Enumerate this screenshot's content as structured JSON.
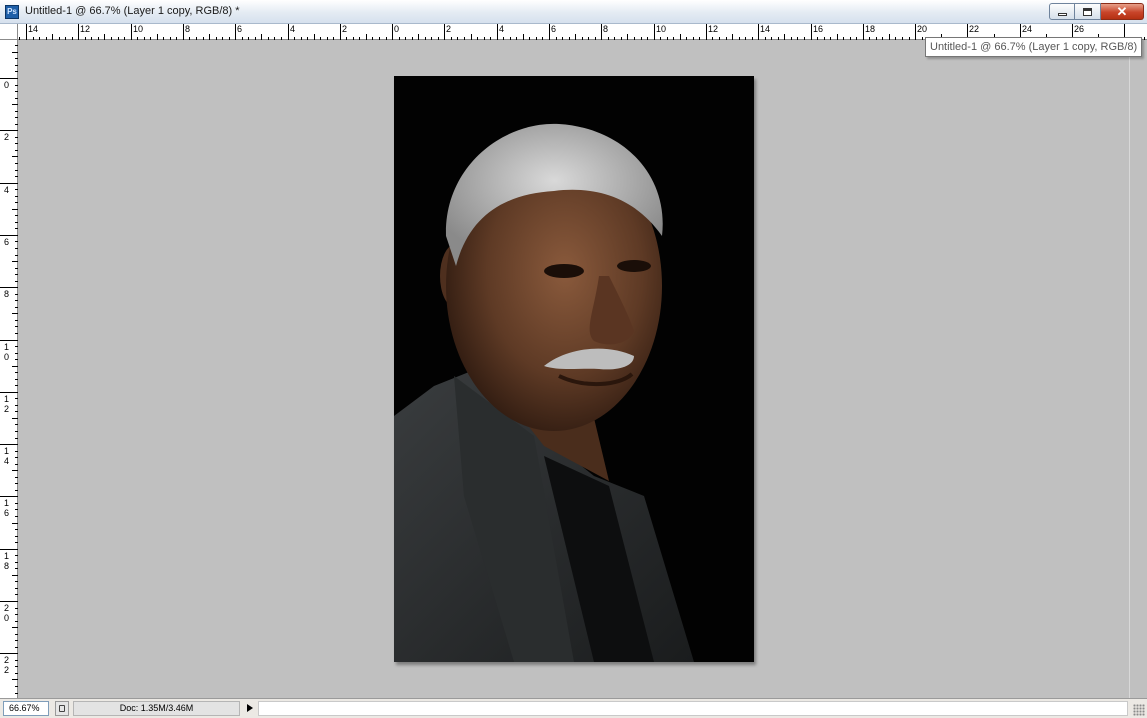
{
  "window": {
    "app_icon_label": "Ps",
    "title": "Untitled-1 @ 66.7% (Layer 1 copy, RGB/8) *",
    "close_glyph": "✕"
  },
  "tooltip": "Untitled-1 @ 66.7% (Layer 1 copy, RGB/8)",
  "rulers": {
    "top_labels": [
      "14",
      "12",
      "10",
      "8",
      "6",
      "4",
      "2",
      "0",
      "2",
      "4",
      "6",
      "8",
      "10",
      "12",
      "14",
      "16",
      "18",
      "20",
      "22",
      "24",
      "26"
    ],
    "left_labels": [
      "0",
      "2",
      "4",
      "6",
      "8",
      "10",
      "12",
      "14",
      "16",
      "18",
      "20",
      "22"
    ]
  },
  "document": {
    "image_description": "portrait photo"
  },
  "status": {
    "zoom": "66.67%",
    "doc_info": "Doc: 1.35M/3.46M"
  },
  "icons": [
    "photoshop-app-icon",
    "minimize-icon",
    "maximize-icon",
    "close-icon",
    "document-status-icon",
    "menu-arrow-icon",
    "resize-grip-icon"
  ]
}
